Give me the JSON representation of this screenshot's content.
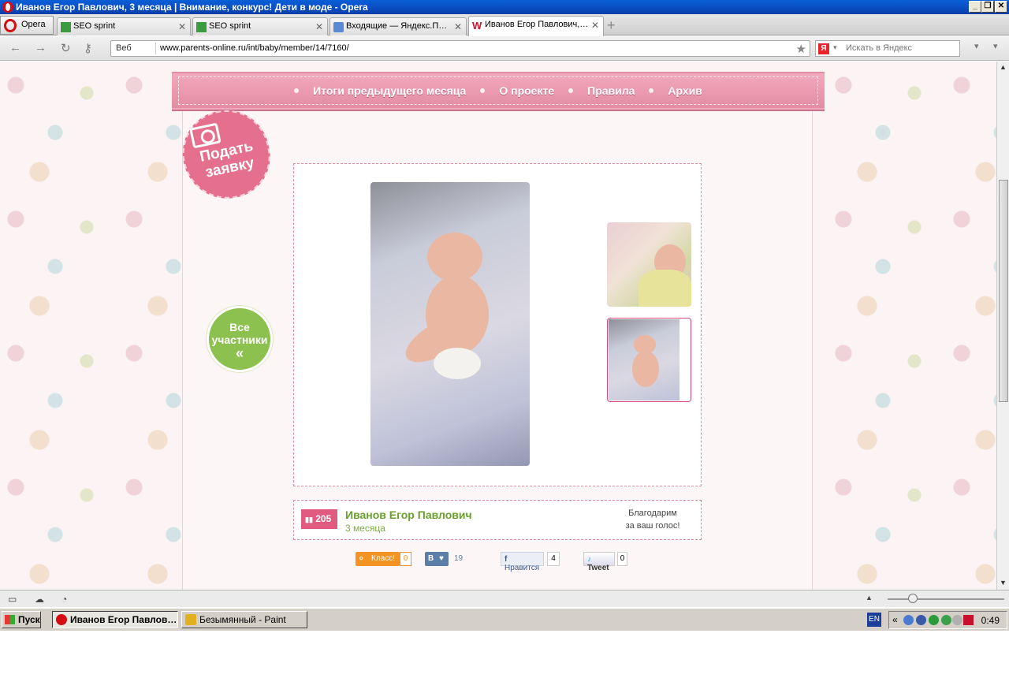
{
  "window": {
    "title": "Иванов Егор Павлович, 3 месяца | Внимание, конкурс! Дети в моде - Opera",
    "controls": {
      "minimize": "_",
      "maximize": "❐",
      "close": "✕"
    }
  },
  "browser": {
    "menu_label": "Opera",
    "tabs": [
      {
        "label": "SEO sprint",
        "icon": "seosprint-icon"
      },
      {
        "label": "SEO sprint",
        "icon": "seosprint-icon"
      },
      {
        "label": "Входящие — Яндекс.П…",
        "icon": "mail-icon"
      },
      {
        "label": "Иванов Егор Павлович,…",
        "icon": "site-w-icon"
      }
    ],
    "address": {
      "security_label": "Веб",
      "url": "www.parents-online.ru/int/baby/member/14/7160/"
    },
    "search": {
      "engine_letter": "Я",
      "placeholder": "Искать в Яндекс"
    }
  },
  "page": {
    "menu": [
      "Итоги предыдущего месяца",
      "О проекте",
      "Правила",
      "Архив"
    ],
    "apply_badge": "Подать заявку",
    "all_participants_badge": "Все участники",
    "all_participants_arrow": "«",
    "participant": {
      "votes": "205",
      "name": "Иванов Егор Павлович",
      "age": "3 месяца",
      "thanks_line1": "Благодарим",
      "thanks_line2": "за ваш голос!"
    },
    "share": {
      "ok_label": "Класс!",
      "ok_count": "0",
      "vk_label": "В",
      "vk_count": "19",
      "fb_label": "Нравится",
      "fb_count": "4",
      "tw_label": "Tweet",
      "tw_count": "0"
    }
  },
  "taskbar": {
    "start_label": "Пуск",
    "tasks": [
      {
        "label": "Иванов Егор Павлов…",
        "active": true
      },
      {
        "label": "Безымянный - Paint",
        "active": false
      }
    ],
    "lang": "EN",
    "tray_chevron": "«",
    "clock": "0:49"
  },
  "colors": {
    "ribbon_pink": "#e38ca4",
    "badge_pink": "#e5708e",
    "badge_green": "#8cc04f",
    "name_green": "#6a9f2d",
    "votes_pink": "#e05b7f"
  }
}
